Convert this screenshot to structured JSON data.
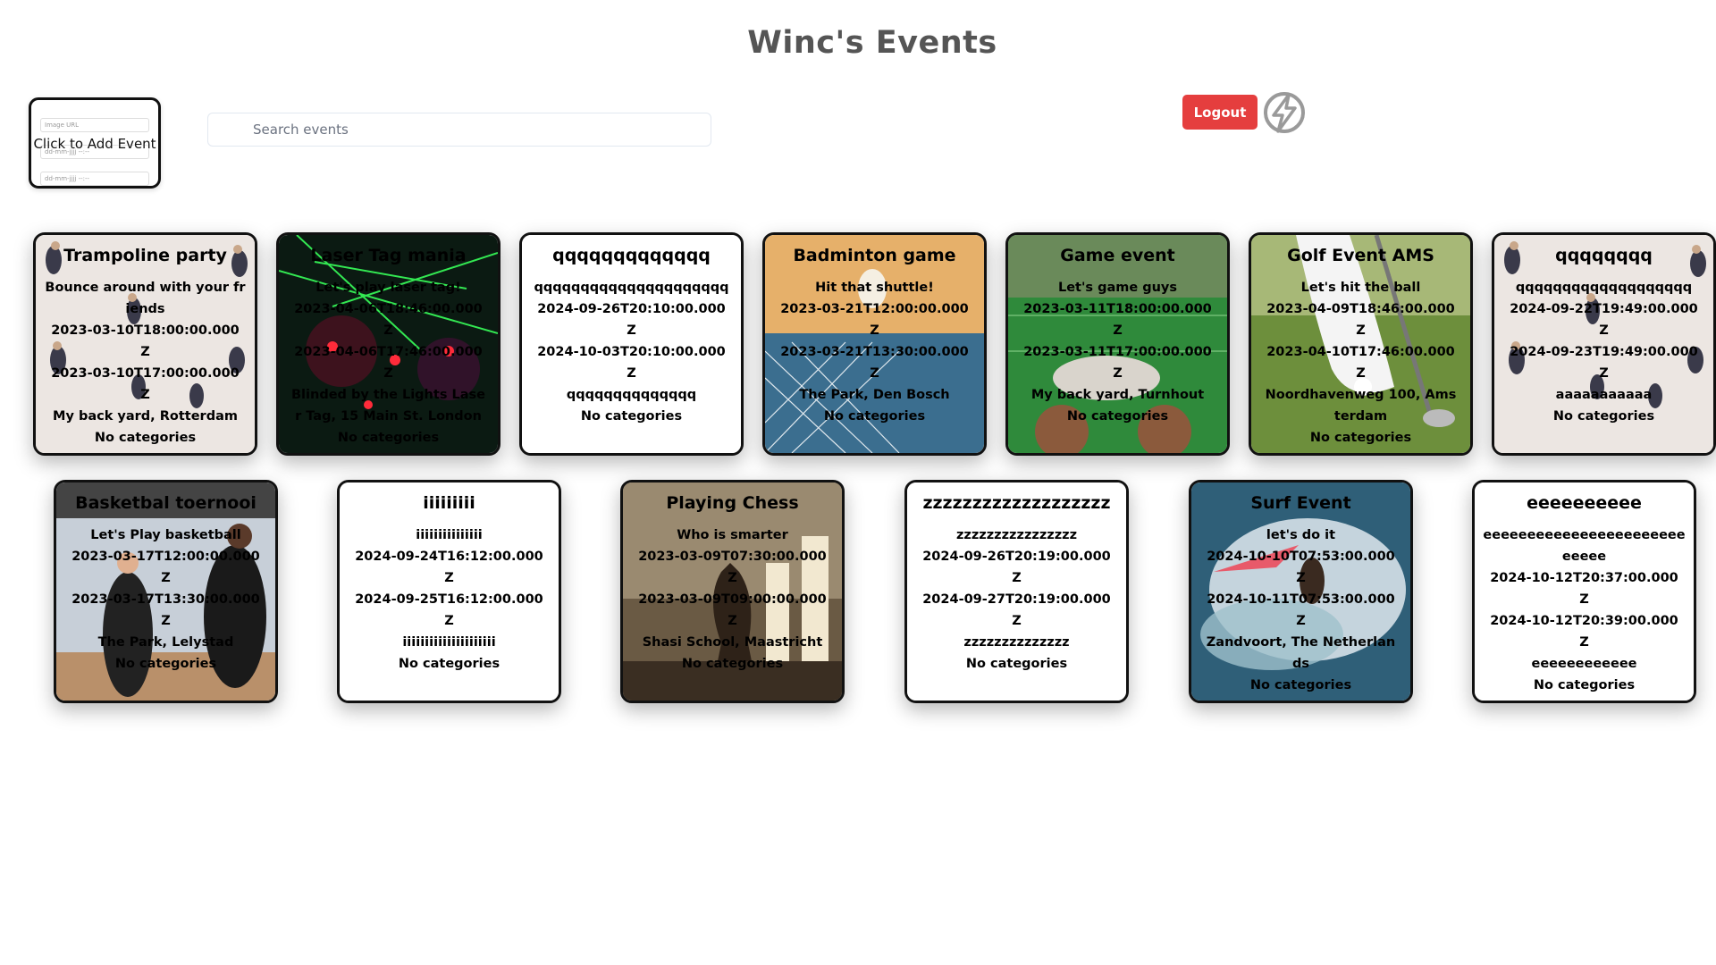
{
  "app": {
    "title": "Winc's Events",
    "add_event_label": "Click to Add Event",
    "add_event_ghost_image": "Image URL",
    "add_event_ghost_date1": "dd-mm-jjjj --:--",
    "add_event_ghost_date2": "dd-mm-jjjj --:--",
    "search_placeholder": "Search events",
    "search_value": "",
    "logout_label": "Logout",
    "accent_color": "#e53e3e",
    "logo_icon": "lightning-bolt-icon"
  },
  "events": [
    {
      "title": "Trampoline party",
      "description": "Bounce around with your friends",
      "start": "2023-03-10T18:00:00.000Z",
      "end": "2023-03-10T17:00:00.000Z",
      "location": "My back yard, Rotterdam",
      "categories": "No categories",
      "bg": "trampoline"
    },
    {
      "title": "Laser Tag mania",
      "description": "Let's play laser tag!",
      "start": "2023-04-06T18:46:00.000Z",
      "end": "2023-04-06T17:46:00.000Z",
      "location": "Blinded by the Lights Laser Tag, 15 Main St. London",
      "categories": "No categories",
      "bg": "laser"
    },
    {
      "title": "qqqqqqqqqqqqq",
      "description": "qqqqqqqqqqqqqqqqqqqqq",
      "start": "2024-09-26T20:10:00.000Z",
      "end": "2024-10-03T20:10:00.000Z",
      "location": "qqqqqqqqqqqqqq",
      "categories": "No categories",
      "bg": "plain"
    },
    {
      "title": "Badminton game",
      "description": "Hit that shuttle!",
      "start": "2023-03-21T12:00:00.000Z",
      "end": "2023-03-21T13:30:00.000Z",
      "location": "The Park, Den Bosch",
      "categories": "No categories",
      "bg": "badminton"
    },
    {
      "title": "Game event",
      "description": "Let's game guys",
      "start": "2023-03-11T18:00:00.000Z",
      "end": "2023-03-11T17:00:00.000Z",
      "location": "My back yard, Turnhout",
      "categories": "No categories",
      "bg": "game"
    },
    {
      "title": "Golf Event AMS",
      "description": "Let's hit the ball",
      "start": "2023-04-09T18:46:00.000Z",
      "end": "2023-04-10T17:46:00.000Z",
      "location": "Noordhavenweg 100, Amsterdam",
      "categories": "No categories",
      "bg": "golf"
    },
    {
      "title": "qqqqqqqq",
      "description": "qqqqqqqqqqqqqqqqqqq",
      "start": "2024-09-22T19:49:00.000Z",
      "end": "2024-09-23T19:49:00.000Z",
      "location": "aaaaaaaaaaa",
      "categories": "No categories",
      "bg": "trampoline"
    },
    {
      "title": "Basketbal toernooi",
      "description": "Let's Play basketball",
      "start": "2023-03-17T12:00:00.000Z",
      "end": "2023-03-17T13:30:00.000Z",
      "location": "The Park, Lelystad",
      "categories": "No categories",
      "bg": "basketball"
    },
    {
      "title": "iiiiiiiii",
      "description": "iiiiiiiiiiiiiii",
      "start": "2024-09-24T16:12:00.000Z",
      "end": "2024-09-25T16:12:00.000Z",
      "location": "iiiiiiiiiiiiiiiiiiiii",
      "categories": "No categories",
      "bg": "plain"
    },
    {
      "title": "Playing Chess",
      "description": "Who is smarter",
      "start": "2023-03-09T07:30:00.000Z",
      "end": "2023-03-09T09:00:00.000Z",
      "location": "Shasi School, Maastricht",
      "categories": "No categories",
      "bg": "chess"
    },
    {
      "title": "zzzzzzzzzzzzzzzzzzz",
      "description": "zzzzzzzzzzzzzzzz",
      "start": "2024-09-26T20:19:00.000Z",
      "end": "2024-09-27T20:19:00.000Z",
      "location": "zzzzzzzzzzzzzz",
      "categories": "No categories",
      "bg": "plain"
    },
    {
      "title": "Surf Event",
      "description": "let's do it",
      "start": "2024-10-10T07:53:00.000Z",
      "end": "2024-10-11T07:53:00.000Z",
      "location": "Zandvoort, The Netherlands",
      "categories": "No categories",
      "bg": "surf"
    },
    {
      "title": "eeeeeeeeee",
      "description": "eeeeeeeeeeeeeeeeeeeeeeeeeeee",
      "start": "2024-10-12T20:37:00.000Z",
      "end": "2024-10-12T20:39:00.000Z",
      "location": "eeeeeeeeeeee",
      "categories": "No categories",
      "bg": "plain"
    }
  ]
}
